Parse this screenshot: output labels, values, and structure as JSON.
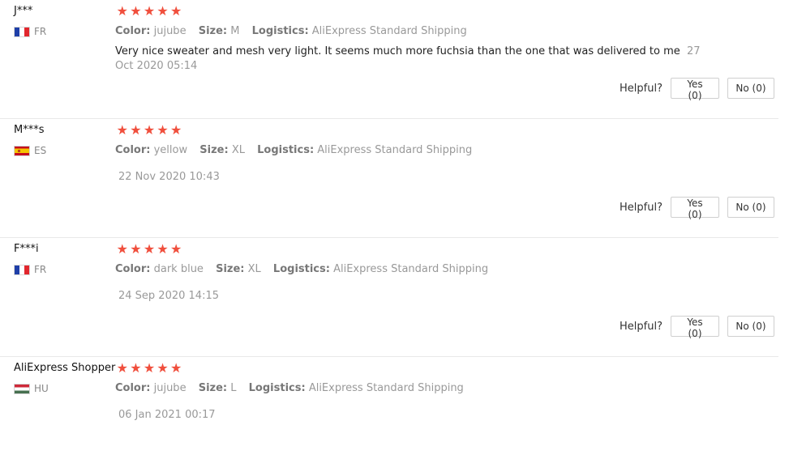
{
  "helpful_label": "Helpful?",
  "attr_labels": {
    "color": "Color:",
    "size": "Size:",
    "logistics": "Logistics:"
  },
  "star_color": "#f04f3d",
  "reviews": [
    {
      "user": "J***",
      "country_code": "FR",
      "flag": "france-flag-icon",
      "rating": 5,
      "color": "jujube",
      "size": "M",
      "logistics": "AliExpress Standard Shipping",
      "text": "Very nice sweater and mesh very light. It seems much more fuchsia than the one that was delivered to me",
      "date": "27 Oct 2020 05:14",
      "yes": "Yes (0)",
      "no": "No (0)"
    },
    {
      "user": "M***s",
      "country_code": "ES",
      "flag": "spain-flag-icon",
      "rating": 5,
      "color": "yellow",
      "size": "XL",
      "logistics": "AliExpress Standard Shipping",
      "text": "",
      "date": "22 Nov 2020 10:43",
      "yes": "Yes (0)",
      "no": "No (0)"
    },
    {
      "user": "F***i",
      "country_code": "FR",
      "flag": "france-flag-icon",
      "rating": 5,
      "color": "dark blue",
      "size": "XL",
      "logistics": "AliExpress Standard Shipping",
      "text": "",
      "date": "24 Sep 2020 14:15",
      "yes": "Yes (0)",
      "no": "No (0)"
    },
    {
      "user": "AliExpress Shopper",
      "country_code": "HU",
      "flag": "hungary-flag-icon",
      "rating": 5,
      "color": "jujube",
      "size": "L",
      "logistics": "AliExpress Standard Shipping",
      "text": "",
      "date": "06 Jan 2021 00:17"
    }
  ]
}
